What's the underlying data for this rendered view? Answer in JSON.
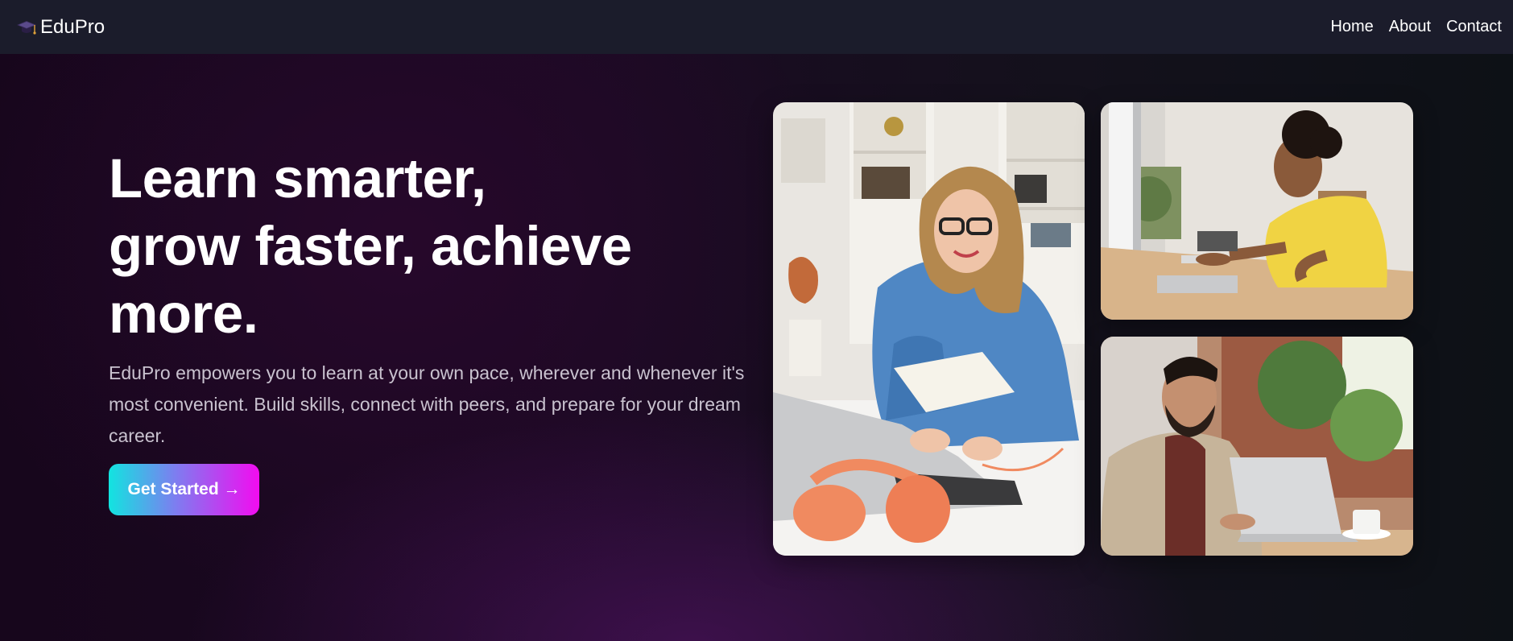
{
  "brand": {
    "name": "EduPro",
    "icon": "graduation-cap-icon"
  },
  "nav": {
    "items": [
      {
        "label": "Home"
      },
      {
        "label": "About"
      },
      {
        "label": "Contact"
      }
    ]
  },
  "hero": {
    "title_lines": [
      "Learn smarter,",
      "grow faster, achieve",
      "more."
    ],
    "description": "EduPro empowers you to learn at your own pace, wherever and whenever it's most convenient. Build skills, connect with peers, and prepare for your dream career.",
    "cta_label": "Get Started →"
  },
  "colors": {
    "navbar_bg": "#1b1c2b",
    "cta_gradient_start": "#12e4e0",
    "cta_gradient_end": "#f20cf0",
    "text_primary": "#ffffff",
    "text_secondary": "#c9c2cf"
  }
}
